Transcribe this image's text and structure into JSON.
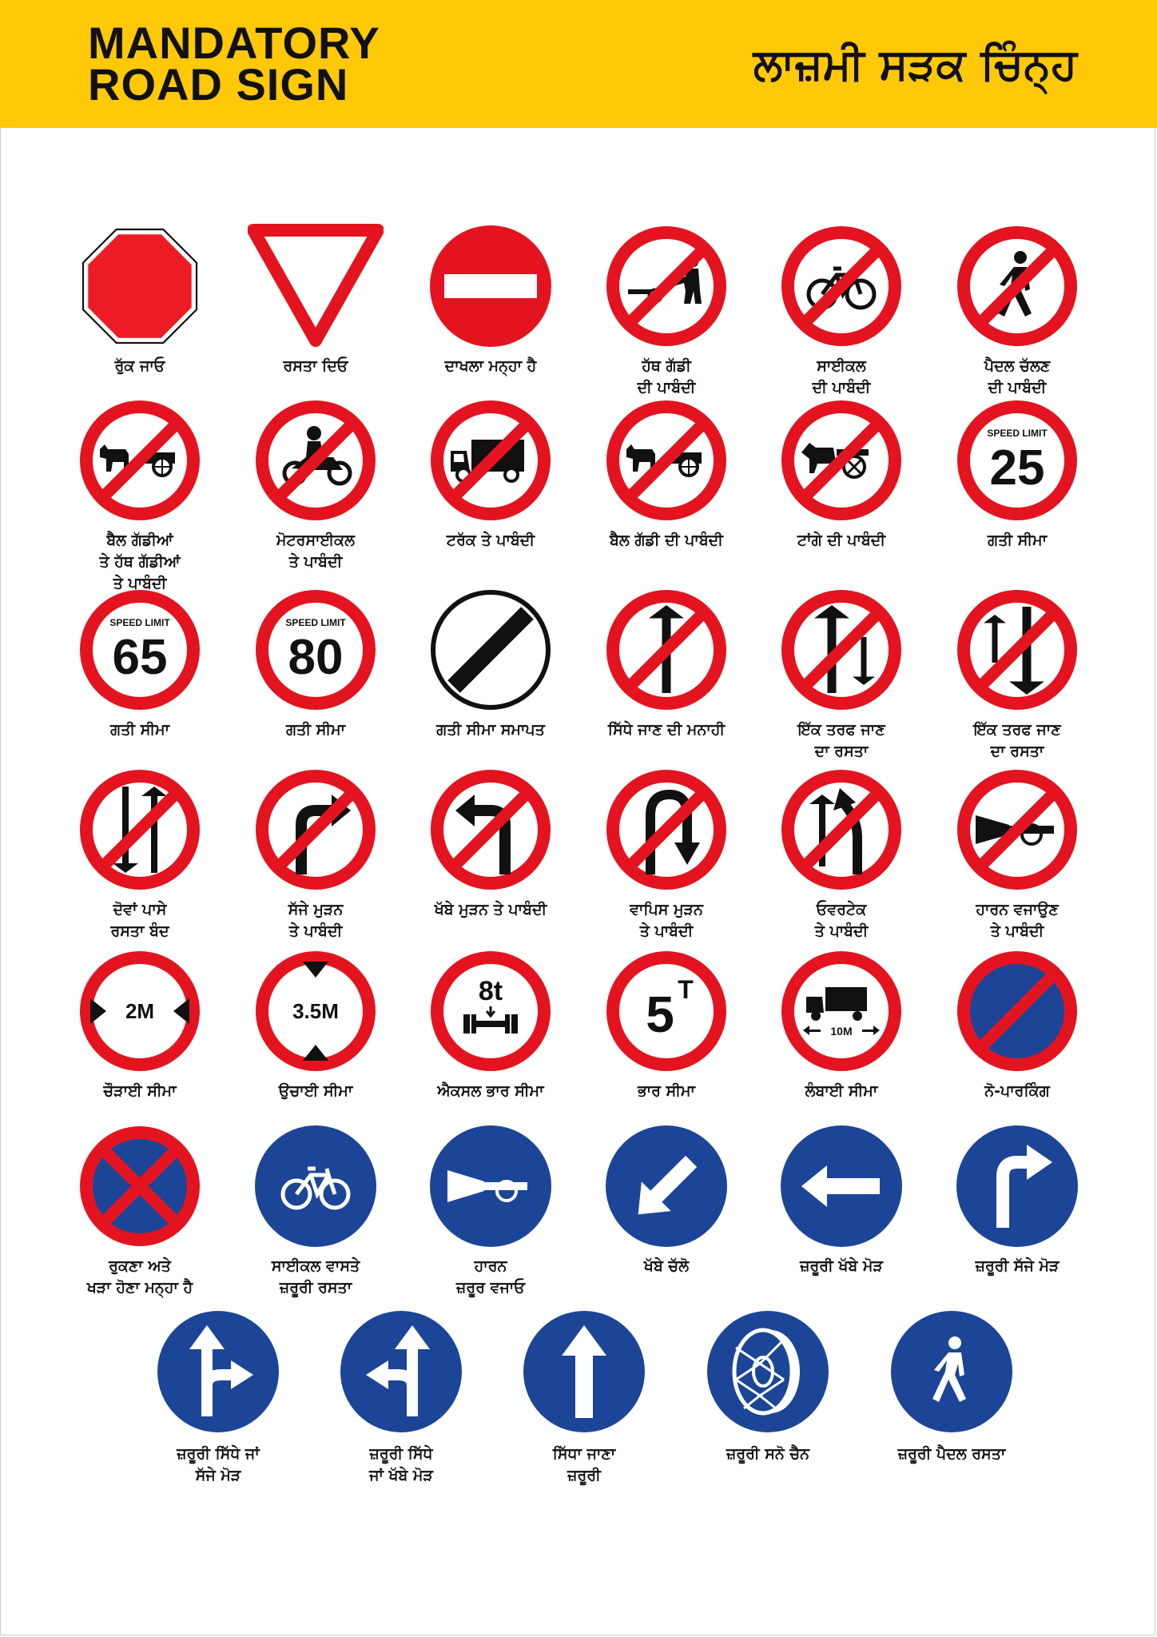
{
  "header": {
    "title_en": "MANDATORY\nROAD SIGN",
    "title_pa": "ਲਾਜ਼ਮੀ ਸੜਕ ਚਿੰਨ੍ਹ"
  },
  "colors": {
    "header_bg": "#ffc809",
    "prohibition_red": "#e3141f",
    "mandatory_blue": "#1d4597",
    "stop_red": "#ed1c24"
  },
  "rows": [
    [
      {
        "icon": "stop-octagon-icon",
        "label": "ਰੁੱਕ ਜਾਓ"
      },
      {
        "icon": "give-way-triangle-icon",
        "label": "ਰਸਤਾ ਦਿਓ"
      },
      {
        "icon": "no-entry-icon",
        "label": "ਦਾਖਲਾ ਮਨ੍ਹਾ ਹੈ"
      },
      {
        "icon": "no-handcart-icon",
        "label": "ਹੱਥ ਗੱਡੀ\nਦੀ ਪਾਬੰਦੀ"
      },
      {
        "icon": "no-bicycle-icon",
        "label": "ਸਾਈਕਲ\nਦੀ ਪਾਬੰਦੀ"
      },
      {
        "icon": "no-pedestrian-icon",
        "label": "ਪੈਦਲ ਚੱਲਣ\nਦੀ ਪਾਬੰਦੀ"
      }
    ],
    [
      {
        "icon": "no-bullock-and-hand-cart-icon",
        "label": "ਬੈਲ ਗੱਡੀਆਂ\nਤੇ ਹੱਥ ਗੱਡੀਆਂ\nਤੇ ਪਾਬੰਦੀ"
      },
      {
        "icon": "no-motorcycle-icon",
        "label": "ਮੋਟਰਸਾਈਕਲ\nਤੇ ਪਾਬੰਦੀ"
      },
      {
        "icon": "no-truck-icon",
        "label": "ਟਰੱਕ ਤੇ ਪਾਬੰਦੀ"
      },
      {
        "icon": "no-bullock-cart-icon",
        "label": "ਬੈਲ ਗੱਡੀ ਦੀ ਪਾਬੰਦੀ"
      },
      {
        "icon": "no-tonga-icon",
        "label": "ਟਾਂਗੇ ਦੀ ਪਾਬੰਦੀ"
      },
      {
        "icon": "speed-limit-icon",
        "label": "ਗਤੀ  ਸੀਮਾ",
        "sign_top": "SPEED LIMIT",
        "sign_value": "25"
      }
    ],
    [
      {
        "icon": "speed-limit-icon",
        "label": "ਗਤੀ  ਸੀਮਾ",
        "sign_top": "SPEED LIMIT",
        "sign_value": "65"
      },
      {
        "icon": "speed-limit-icon",
        "label": "ਗਤੀ  ਸੀਮਾ",
        "sign_top": "SPEED LIMIT",
        "sign_value": "80"
      },
      {
        "icon": "end-of-speed-limit-icon",
        "label": "ਗਤੀ  ਸੀਮਾ ਸਮਾਪਤ"
      },
      {
        "icon": "no-straight-ahead-icon",
        "label": "ਸਿੱਧੇ ਜਾਣ ਦੀ ਮਨਾਹੀ"
      },
      {
        "icon": "one-way-up-icon",
        "label": "ਇੱਕ ਤਰਫ ਜਾਣ\nਦਾ ਰਸਤਾ"
      },
      {
        "icon": "one-way-down-icon",
        "label": "ਇੱਕ ਤਰਫ ਜਾਣ\nਦਾ ਰਸਤਾ"
      }
    ],
    [
      {
        "icon": "two-way-closed-icon",
        "label": "ਦੋਵਾਂ ਪਾਸੇ\nਰਸਤਾ ਬੰਦ"
      },
      {
        "icon": "no-right-turn-icon",
        "label": "ਸੱਜੇ ਮੁੜਨ\nਤੇ ਪਾਬੰਦੀ"
      },
      {
        "icon": "no-left-turn-icon",
        "label": "ਖੱਬੇ ਮੁੜਨ ਤੇ ਪਾਬੰਦੀ"
      },
      {
        "icon": "no-u-turn-icon",
        "label": "ਵਾਪਿਸ ਮੁੜਨ\nਤੇ ਪਾਬੰਦੀ"
      },
      {
        "icon": "no-overtaking-icon",
        "label": "ਓਵਰਟੇਕ\nਤੇ ਪਾਬੰਦੀ"
      },
      {
        "icon": "no-horn-icon",
        "label": "ਹਾਰਨ ਵਜਾਉਣ\nਤੇ ਪਾਬੰਦੀ"
      }
    ],
    [
      {
        "icon": "width-limit-icon",
        "label": "ਚੌੜਾਈ ਸੀਮਾ",
        "sign_value": "2M"
      },
      {
        "icon": "height-limit-icon",
        "label": "ਉਚਾਈ ਸੀਮਾ",
        "sign_value": "3.5M"
      },
      {
        "icon": "axle-load-limit-icon",
        "label": "ਐਕਸਲ ਭਾਰ ਸੀਮਾ",
        "sign_value": "8t"
      },
      {
        "icon": "load-limit-icon",
        "label": "ਭਾਰ ਸੀਮਾ",
        "sign_value": "5",
        "sign_top": "T"
      },
      {
        "icon": "length-limit-icon",
        "label": "ਲੰਬਾਈ ਸੀਮਾ",
        "sign_value": "10M"
      },
      {
        "icon": "no-parking-icon",
        "label": "ਨੋ-ਪਾਰਕਿੰਗ"
      }
    ],
    [
      {
        "icon": "no-stopping-icon",
        "label": "ਰੁਕਣਾ ਅਤੇ\nਖੜਾ ਹੋਣਾ ਮਨ੍ਹਾ ਹੈ"
      },
      {
        "icon": "cycle-track-icon",
        "label": "ਸਾਈਕਲ ਵਾਸਤੇ\nਜ਼ਰੂਰੀ ਰਸਤਾ"
      },
      {
        "icon": "sound-horn-icon",
        "label": "ਹਾਰਨ\nਜ਼ਰੂਰ ਵਜਾਓ"
      },
      {
        "icon": "keep-left-icon",
        "label": "ਖੱਬੇ ਚੱਲੋ"
      },
      {
        "icon": "compulsory-left-turn-icon",
        "label": "ਜ਼ਰੂਰੀ ਖੱਬੇ ਮੋੜ"
      },
      {
        "icon": "compulsory-right-turn-icon",
        "label": "ਜ਼ਰੂਰੀ ਸੱਜੇ ਮੋੜ"
      }
    ],
    [
      {
        "icon": "ahead-or-right-icon",
        "label": "ਜ਼ਰੂਰੀ ਸਿੱਧੇ ਜਾਂ\nਸੱਜੇ ਮੋੜ"
      },
      {
        "icon": "ahead-or-left-icon",
        "label": "ਜ਼ਰੂਰੀ ਸਿੱਧੇ\nਜਾਂ ਖੱਬੇ ਮੋੜ"
      },
      {
        "icon": "compulsory-ahead-icon",
        "label": "ਸਿੱਧਾ ਜਾਣਾ\nਜ਼ਰੂਰੀ"
      },
      {
        "icon": "snow-chain-icon",
        "label": "ਜ਼ਰੂਰੀ  ਸਨੋ ਚੈਨ"
      },
      {
        "icon": "pedestrian-path-icon",
        "label": "ਜ਼ਰੂਰੀ ਪੈਦਲ ਰਸਤਾ"
      }
    ]
  ]
}
